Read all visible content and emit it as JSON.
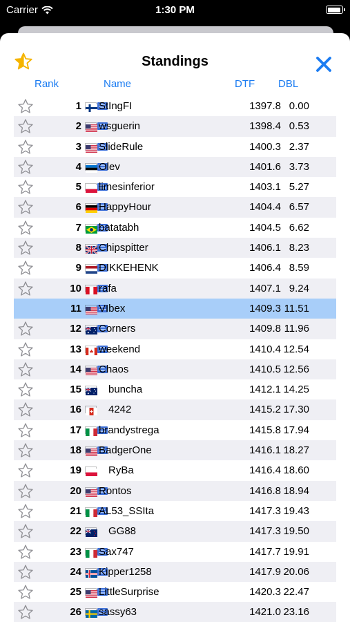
{
  "status_bar": {
    "carrier": "Carrier",
    "time": "1:30 PM"
  },
  "sheet": {
    "title": "Standings"
  },
  "columns": {
    "rank": "Rank",
    "name": "Name",
    "dtf": "DTF",
    "dbl": "DBL"
  },
  "colors": {
    "accent": "#1b7cf2",
    "selected_row": "#a8cef9",
    "alt_row": "#efeff4",
    "favorite_star": "#f5b400"
  },
  "selected_rank": 11,
  "rows": [
    {
      "rank": "1",
      "flag": "finland",
      "badge": true,
      "name": "StIngFI",
      "dtf": "1397.8",
      "dbl": "0.00"
    },
    {
      "rank": "2",
      "flag": "usa",
      "badge": true,
      "name": "wsguerin",
      "dtf": "1398.4",
      "dbl": "0.53"
    },
    {
      "rank": "3",
      "flag": "usa",
      "badge": true,
      "name": "SlideRule",
      "dtf": "1400.3",
      "dbl": "2.37"
    },
    {
      "rank": "4",
      "flag": "estonia",
      "badge": true,
      "name": "Olev",
      "dtf": "1401.6",
      "dbl": "3.73"
    },
    {
      "rank": "5",
      "flag": "poland",
      "badge": true,
      "name": "limesinferior",
      "dtf": "1403.1",
      "dbl": "5.27"
    },
    {
      "rank": "6",
      "flag": "germany",
      "badge": true,
      "name": "HappyHour",
      "dtf": "1404.4",
      "dbl": "6.57"
    },
    {
      "rank": "7",
      "flag": "brazil",
      "badge": true,
      "name": "batatabh",
      "dtf": "1404.5",
      "dbl": "6.62"
    },
    {
      "rank": "8",
      "flag": "uk",
      "badge": true,
      "name": "Chipspitter",
      "dtf": "1406.1",
      "dbl": "8.23"
    },
    {
      "rank": "9",
      "flag": "netherlands",
      "badge": true,
      "name": "DIKKEHENK",
      "dtf": "1406.4",
      "dbl": "8.59"
    },
    {
      "rank": "10",
      "flag": "peru",
      "badge": true,
      "name": "rafa",
      "dtf": "1407.1",
      "dbl": "9.24"
    },
    {
      "rank": "11",
      "flag": "usa",
      "badge": true,
      "name": "VIbex",
      "dtf": "1409.3",
      "dbl": "11.51"
    },
    {
      "rank": "12",
      "flag": "australia",
      "badge": true,
      "name": "Corners",
      "dtf": "1409.8",
      "dbl": "11.96"
    },
    {
      "rank": "13",
      "flag": "canada",
      "badge": true,
      "name": "weekend",
      "dtf": "1410.4",
      "dbl": "12.54"
    },
    {
      "rank": "14",
      "flag": "usa",
      "badge": true,
      "name": "Chaos",
      "dtf": "1410.5",
      "dbl": "12.56"
    },
    {
      "rank": "15",
      "flag": "australia",
      "badge": false,
      "name": "buncha",
      "dtf": "1412.1",
      "dbl": "14.25"
    },
    {
      "rank": "16",
      "flag": "switzerland",
      "badge": false,
      "name": "4242",
      "dtf": "1415.2",
      "dbl": "17.30"
    },
    {
      "rank": "17",
      "flag": "italy",
      "badge": true,
      "name": "brandystrega",
      "dtf": "1415.8",
      "dbl": "17.94"
    },
    {
      "rank": "18",
      "flag": "usa",
      "badge": true,
      "name": "BadgerOne",
      "dtf": "1416.1",
      "dbl": "18.27"
    },
    {
      "rank": "19",
      "flag": "poland",
      "badge": false,
      "name": "RyBa",
      "dtf": "1416.4",
      "dbl": "18.60"
    },
    {
      "rank": "20",
      "flag": "usa",
      "badge": true,
      "name": "Rontos",
      "dtf": "1416.8",
      "dbl": "18.94"
    },
    {
      "rank": "21",
      "flag": "italy",
      "badge": true,
      "name": "AL53_SSIta",
      "dtf": "1417.3",
      "dbl": "19.43"
    },
    {
      "rank": "22",
      "flag": "new-zealand",
      "badge": false,
      "name": "GG88",
      "dtf": "1417.3",
      "dbl": "19.50"
    },
    {
      "rank": "23",
      "flag": "italy",
      "badge": true,
      "name": "Sax747",
      "dtf": "1417.7",
      "dbl": "19.91"
    },
    {
      "rank": "24",
      "flag": "iceland",
      "badge": true,
      "name": "Kipper1258",
      "dtf": "1417.9",
      "dbl": "20.06"
    },
    {
      "rank": "25",
      "flag": "usa",
      "badge": true,
      "name": "LittleSurprise",
      "dtf": "1420.3",
      "dbl": "22.47"
    },
    {
      "rank": "26",
      "flag": "sweden",
      "badge": true,
      "name": "sassy63",
      "dtf": "1421.0",
      "dbl": "23.16"
    }
  ]
}
